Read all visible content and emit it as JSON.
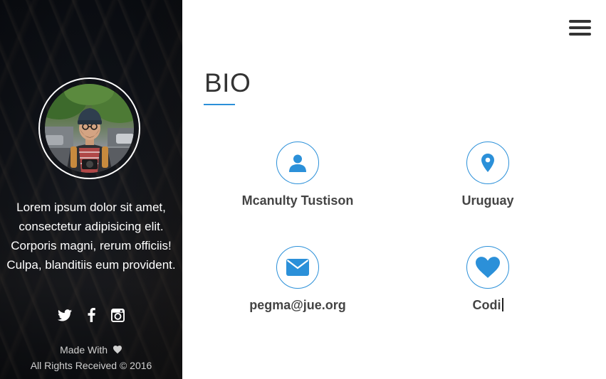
{
  "sidebar": {
    "bio": "Lorem ipsum dolor sit amet, consectetur adipisicing elit. Corporis magni, rerum officiis! Culpa, blanditiis eum provident.",
    "social": [
      {
        "icon": "twitter-icon"
      },
      {
        "icon": "facebook-icon"
      },
      {
        "icon": "instagram-icon"
      }
    ],
    "footer_made_with": "Made With",
    "footer_rights": "All Rights Received © 2016"
  },
  "header": {
    "menu_icon": "hamburger-menu-icon"
  },
  "main": {
    "title": "BIO",
    "accent_color": "#2b90d9",
    "items": [
      {
        "icon": "user-icon",
        "label": "Mcanulty Tustison"
      },
      {
        "icon": "map-marker-icon",
        "label": "Uruguay"
      },
      {
        "icon": "envelope-icon",
        "label": "pegma@jue.org"
      },
      {
        "icon": "heart-icon",
        "label": "Codi"
      }
    ]
  }
}
